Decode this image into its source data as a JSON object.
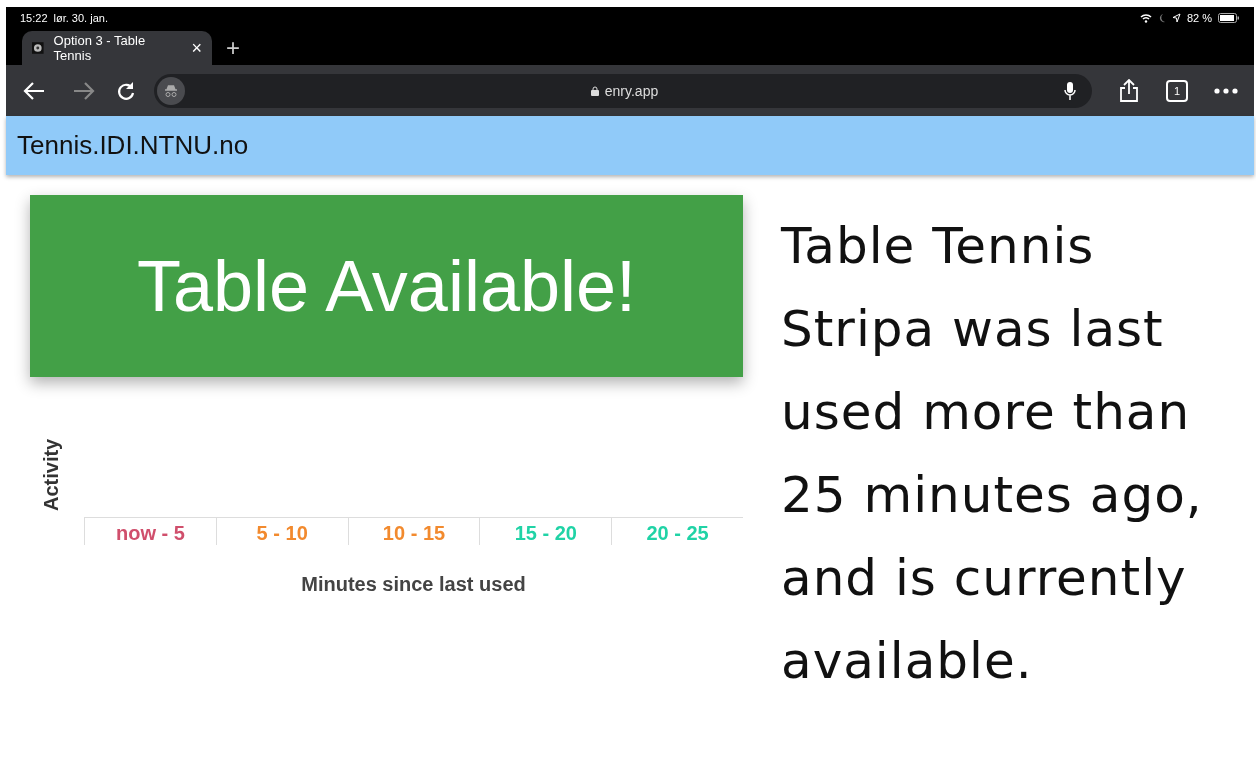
{
  "status_bar": {
    "time": "15:22",
    "date": "lør. 30. jan.",
    "battery": "82 %"
  },
  "tabs": [
    {
      "title": "Option 3 - Table Tennis",
      "close": "×"
    }
  ],
  "new_tab": "+",
  "address_bar": {
    "url": "enry.app"
  },
  "tab_count": "1",
  "site_header": {
    "title": "Tennis.IDI.NTNU.no"
  },
  "status_banner": {
    "text": "Table Available!",
    "available": true
  },
  "chart": {
    "ylabel": "Activity",
    "xlabel": "Minutes since last used",
    "categories": [
      {
        "label": "now - 5",
        "color": "#d04f6c"
      },
      {
        "label": "5 - 10",
        "color": "#f28a2e"
      },
      {
        "label": "10 - 15",
        "color": "#f28a2e"
      },
      {
        "label": "15 - 20",
        "color": "#20d3a6"
      },
      {
        "label": "20 - 25",
        "color": "#20d3a6"
      }
    ]
  },
  "description": "Table Tennis Stripa was last used more than 25 minutes ago, and is currently available."
}
